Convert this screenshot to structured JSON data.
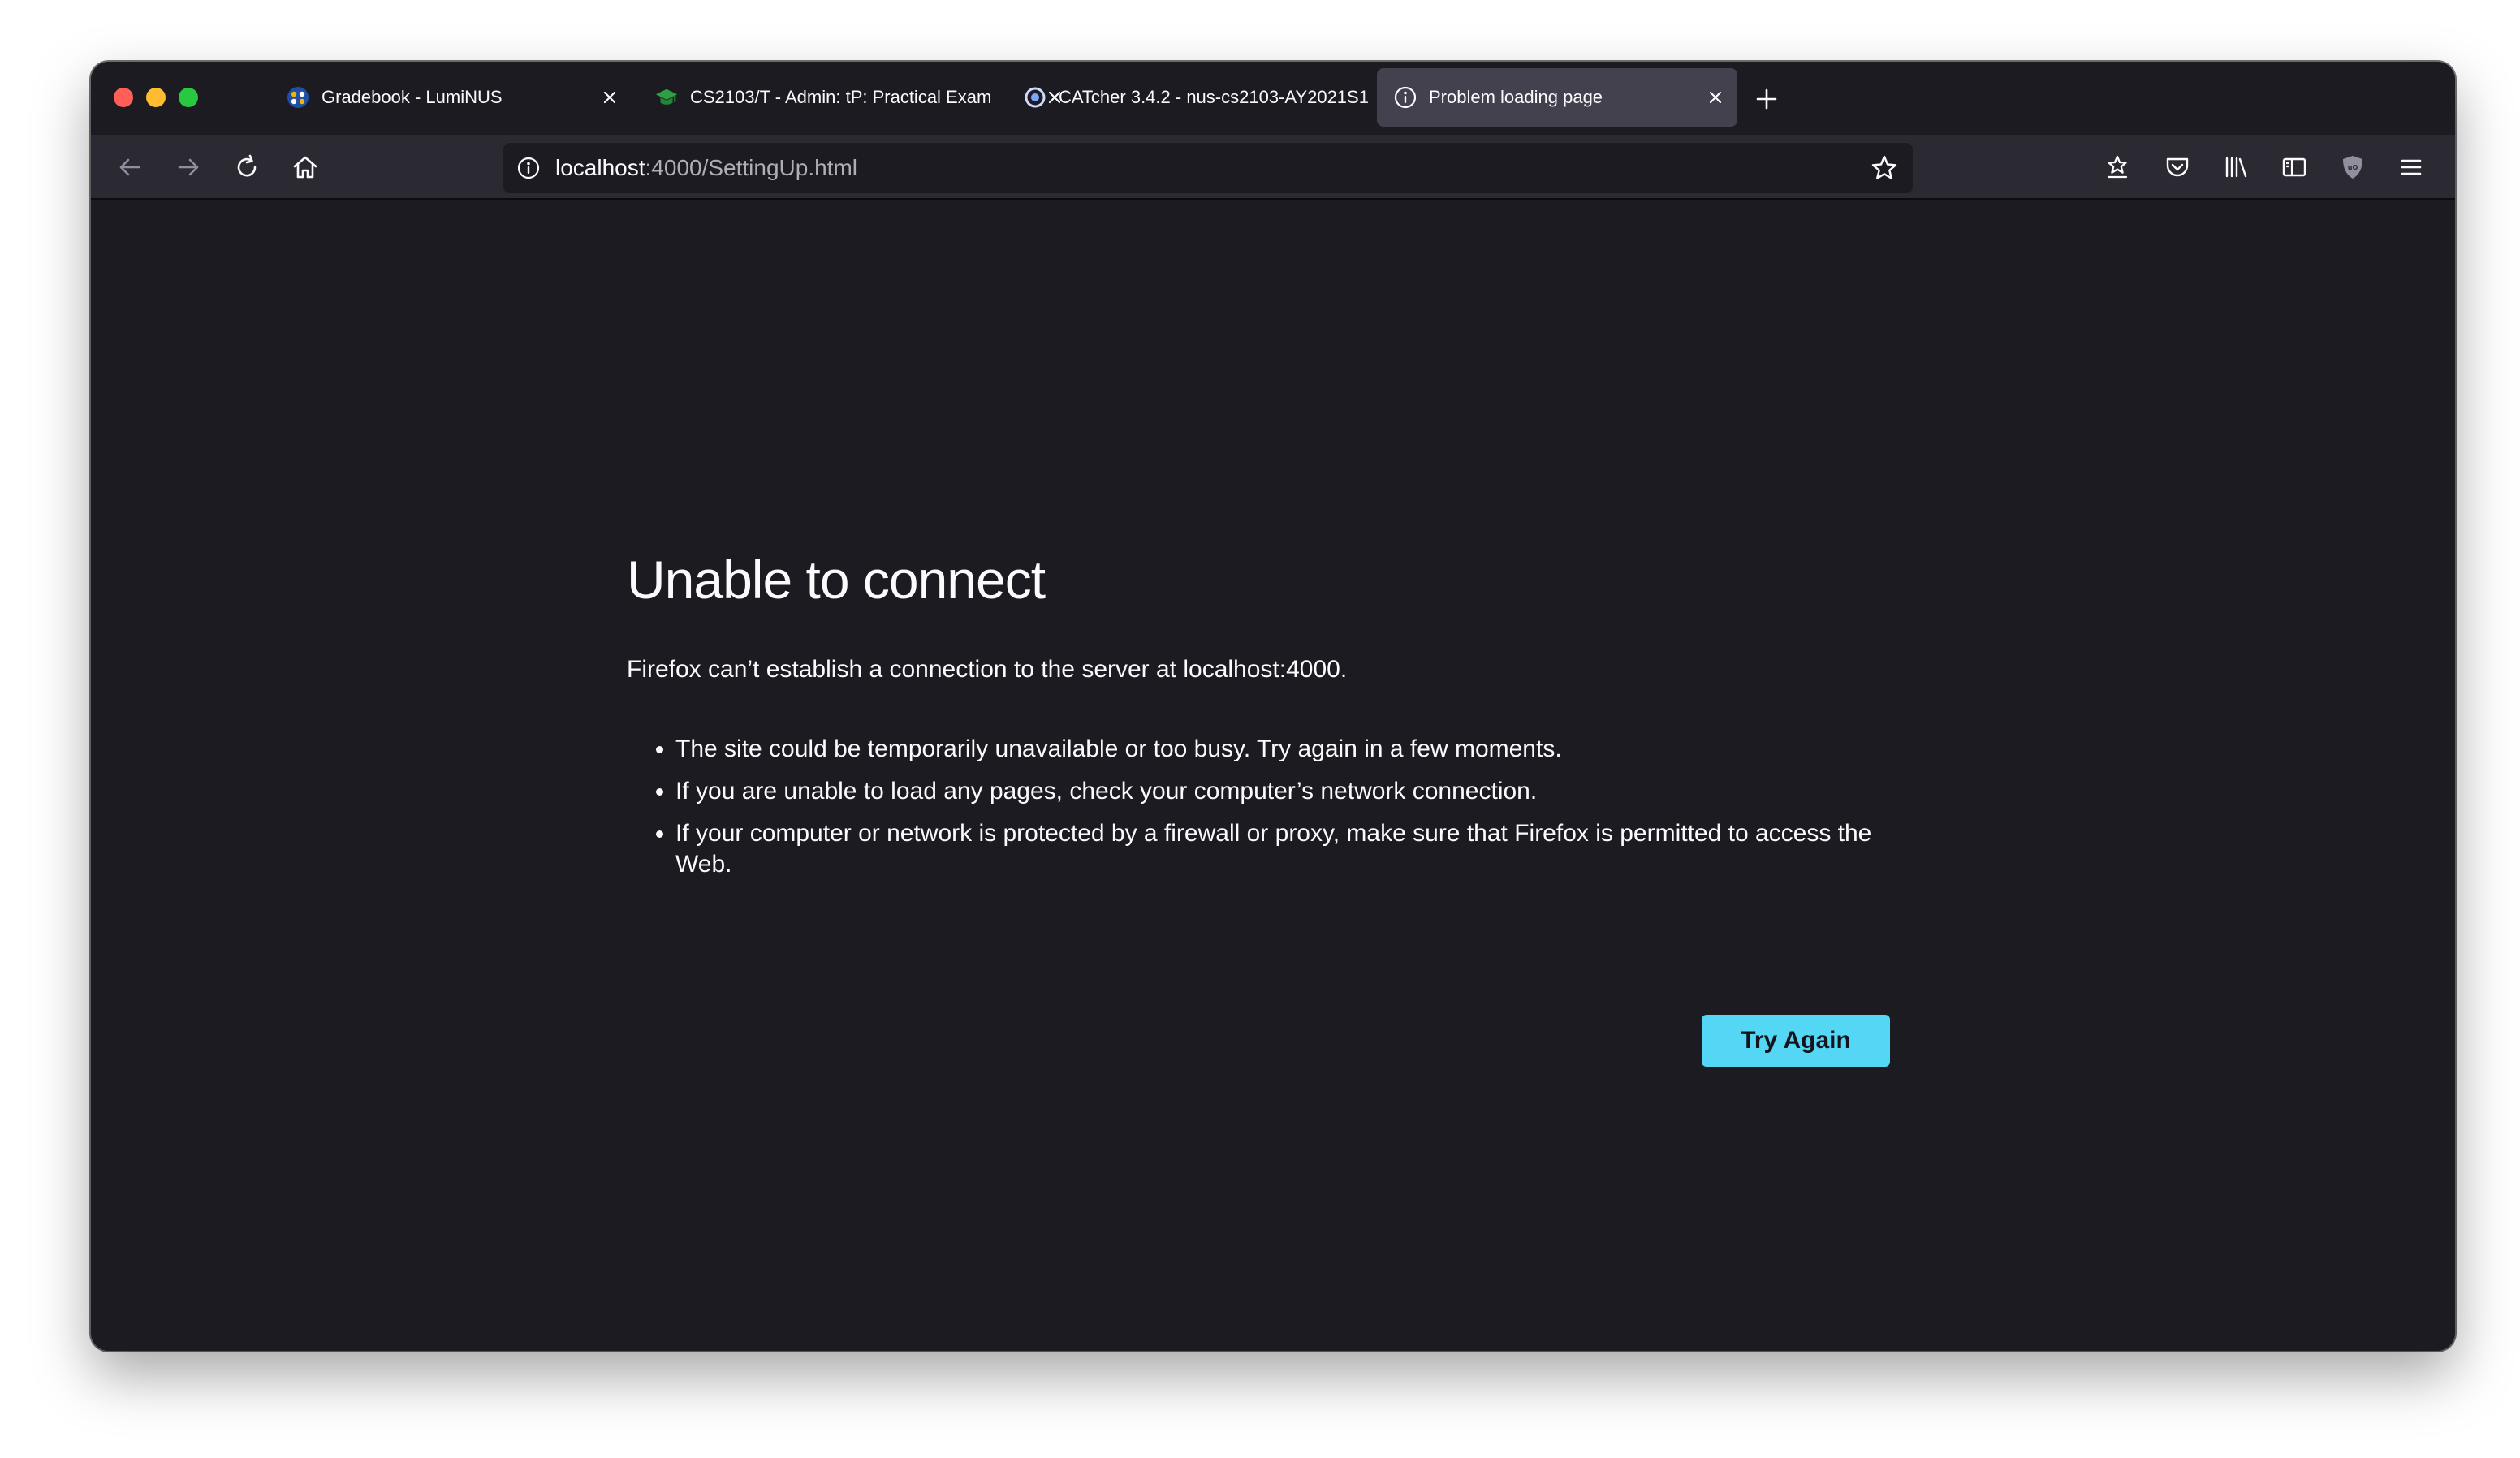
{
  "tabs": [
    {
      "title": "Gradebook - LumiNUS",
      "favicon": "luminus-icon",
      "active": false
    },
    {
      "title": "CS2103/T - Admin: tP: Practical Exam",
      "favicon": "graduation-cap-icon",
      "active": false
    },
    {
      "title": "CATcher 3.4.2 - nus-cs2103-AY2021S1",
      "favicon": "catcher-icon",
      "active": false
    },
    {
      "title": "Problem loading page",
      "favicon": "info-icon",
      "active": true
    }
  ],
  "navbar": {
    "url_host": "localhost",
    "url_rest": ":4000/SettingUp.html"
  },
  "error": {
    "title": "Unable to connect",
    "description": "Firefox can’t establish a connection to the server at localhost:4000.",
    "bullets": [
      "The site could be temporarily unavailable or too busy. Try again in a few moments.",
      "If you are unable to load any pages, check your computer’s network connection.",
      "If your computer or network is protected by a firewall or proxy, make sure that Firefox is permitted to access the Web."
    ],
    "try_again_label": "Try Again"
  },
  "colors": {
    "background": "#1c1b22",
    "toolbar": "#2b2a33",
    "active_tab": "#42414d",
    "button_accent": "#53d7f5",
    "text": "#fbfbfe"
  }
}
